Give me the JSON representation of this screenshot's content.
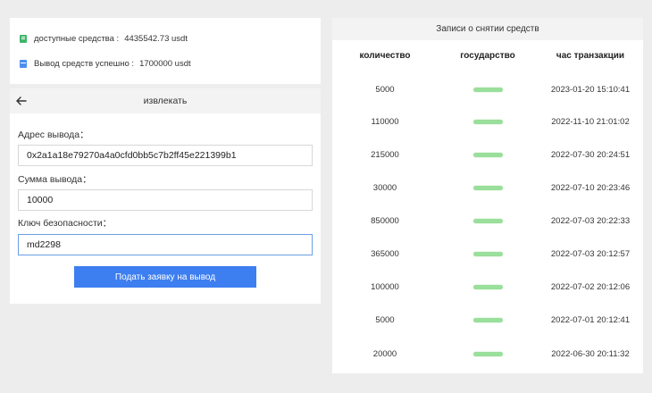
{
  "balance": {
    "available_label": "доступные средства :",
    "available_value": "4435542.73 usdt",
    "success_label": "Вывод средств успешно :",
    "success_value": "1700000 usdt"
  },
  "withdraw": {
    "title": "извлекать",
    "address_label": "Адрес вывода：",
    "address_value": "0x2a1a18e79270a4a0cfd0bb5c7b2ff45e221399b1",
    "amount_label": "Сумма вывода：",
    "amount_value": "10000",
    "key_label": "Ключ безопасности：",
    "key_value": "md2298",
    "submit_label": "Подать заявку на вывод"
  },
  "records": {
    "title": "Записи о снятии средств",
    "columns": [
      "количество",
      "государство",
      "час транзакции"
    ],
    "rows": [
      {
        "amount": "5000",
        "time": "2023-01-20 15:10:41"
      },
      {
        "amount": "110000",
        "time": "2022-11-10 21:01:02"
      },
      {
        "amount": "215000",
        "time": "2022-07-30 20:24:51"
      },
      {
        "amount": "30000",
        "time": "2022-07-10 20:23:46"
      },
      {
        "amount": "850000",
        "time": "2022-07-03 20:22:33"
      },
      {
        "amount": "365000",
        "time": "2022-07-03 20:12:57"
      },
      {
        "amount": "100000",
        "time": "2022-07-02 20:12:06"
      },
      {
        "amount": "5000",
        "time": "2022-07-01 20:12:41"
      },
      {
        "amount": "20000",
        "time": "2022-06-30 20:11:32"
      }
    ]
  },
  "colors": {
    "primary_button": "#3d7ef0",
    "status_blur": "#9adf9b",
    "wallet_icon": "#3fb56a",
    "card_icon": "#4a8ef0"
  }
}
